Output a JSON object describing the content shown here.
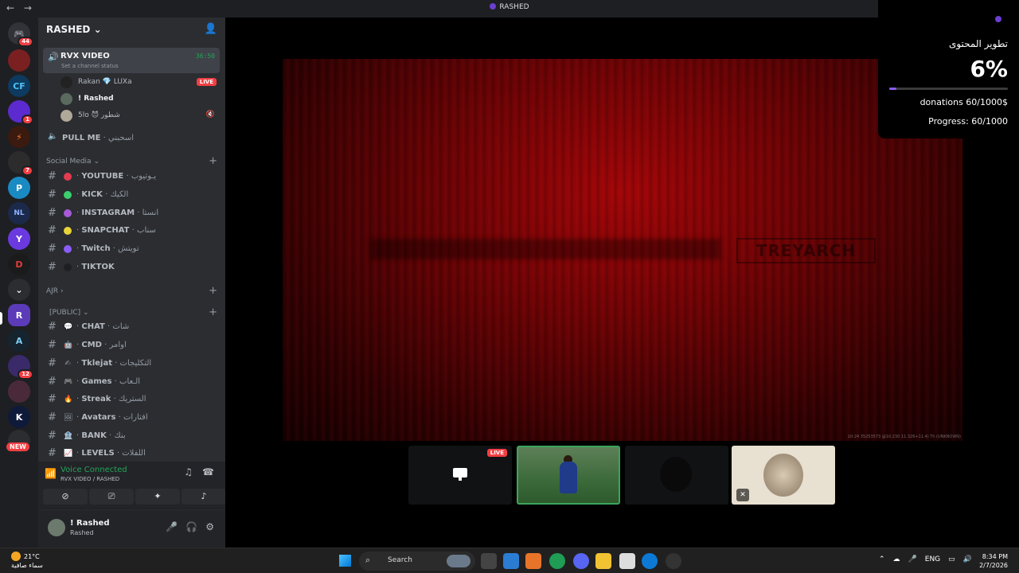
{
  "window": {
    "title": "RASHED",
    "back": "←",
    "forward": "→"
  },
  "servers": {
    "home_badge": "44",
    "badges": {
      "s6": "1",
      "s7": "7",
      "s12": "12"
    },
    "new_label": "NEW"
  },
  "guild": {
    "name": "RASHED"
  },
  "active_voice": {
    "name": "RVX VIDEO",
    "status": "Set a channel status",
    "timer": "36:50",
    "users": [
      {
        "name": "Rakan  💎 LUXa",
        "live": "LIVE"
      },
      {
        "name": "! Rashed"
      },
      {
        "name": "5lo  😈 شطور"
      }
    ]
  },
  "voice_channel2": {
    "name": "PULL ME",
    "ar": "اسحبني"
  },
  "categories": {
    "social": "Social Media",
    "ajr": "AJR",
    "public": "[PUBLIC]"
  },
  "social_channels": [
    {
      "name": "YOUTUBE",
      "ar": "يـوتيوب",
      "color": "#e23c50"
    },
    {
      "name": "KICK",
      "ar": "الكيك",
      "color": "#3ccf6e"
    },
    {
      "name": "INSTAGRAM",
      "ar": "انستا",
      "color": "#a85ad8"
    },
    {
      "name": "SNAPCHAT",
      "ar": "سناب",
      "color": "#e8d43a"
    },
    {
      "name": "Twitch",
      "ar": "تويتش",
      "color": "#8b5cf6"
    },
    {
      "name": "TIKTOK",
      "ar": "",
      "color": "#2b2d31"
    }
  ],
  "public_channels": [
    {
      "emoji": "💬",
      "name": "CHAT",
      "ar": "شات"
    },
    {
      "emoji": "🤖",
      "name": "CMD",
      "ar": "اوامر"
    },
    {
      "emoji": "✍",
      "name": "Tklejat",
      "ar": "التكليجات"
    },
    {
      "emoji": "🎮",
      "name": "Games",
      "ar": "الـعاب"
    },
    {
      "emoji": "🔥",
      "name": "Streak",
      "ar": "الستريك"
    },
    {
      "emoji": "🖼",
      "name": "Avatars",
      "ar": "افتارات"
    },
    {
      "emoji": "🏦",
      "name": "BANK",
      "ar": "بنك"
    },
    {
      "emoji": "📈",
      "name": "LEVELS",
      "ar": "اللفلات"
    }
  ],
  "voice_connection": {
    "status": "Voice Connected",
    "channel": "RVX VIDEO / RASHED"
  },
  "me": {
    "display": "! Rashed",
    "username": "Rashed"
  },
  "stream": {
    "logo_text": "TREYARCH",
    "tile_live": "LIVE",
    "fine_print": "10:24 35253573 @10.230 11.326+11.4) Th (UNKNOWN)"
  },
  "overlay": {
    "title": "تطوير المحتوى",
    "percent_label": "6%",
    "progress_fraction": 0.06,
    "donations": "donations 60/1000$",
    "progress": "Progress: 60/1000",
    "bar_color": "#8b5cf6"
  },
  "taskbar": {
    "temp": "21°C",
    "weather": "سماء صافية",
    "search": "Search",
    "lang": "ENG",
    "time": "8:34 PM",
    "date": "2/7/2026"
  }
}
